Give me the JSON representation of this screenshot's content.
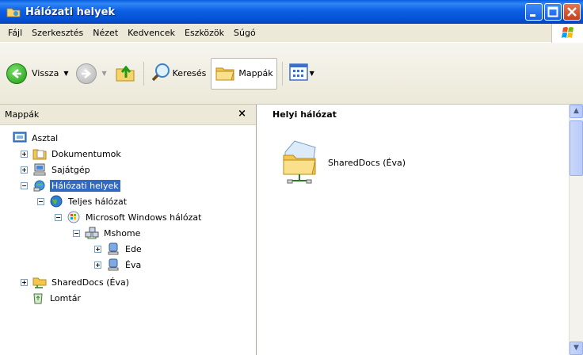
{
  "window": {
    "title": "Hálózati helyek"
  },
  "menu": [
    "Fájl",
    "Szerkesztés",
    "Nézet",
    "Kedvencek",
    "Eszközök",
    "Súgó"
  ],
  "toolbar": {
    "back_label": "Vissza",
    "search_label": "Keresés",
    "folders_label": "Mappák"
  },
  "folder_pane": {
    "title": "Mappák",
    "close_glyph": "×",
    "tree": [
      {
        "label": "Asztal"
      },
      {
        "label": "Dokumentumok",
        "expander": "+"
      },
      {
        "label": "Sajátgép",
        "expander": "+"
      },
      {
        "label": "Hálózati helyek",
        "expander": "−",
        "selected": true
      },
      {
        "label": "Teljes hálózat",
        "expander": "−"
      },
      {
        "label": "Microsoft Windows hálózat",
        "expander": "−"
      },
      {
        "label": "Mshome",
        "expander": "−"
      },
      {
        "label": "Ede",
        "expander": "+"
      },
      {
        "label": "Éva",
        "expander": "+"
      },
      {
        "label": "SharedDocs (Éva)",
        "expander": "+"
      },
      {
        "label": "Lomtár"
      }
    ]
  },
  "content": {
    "group_header": "Helyi hálózat",
    "items": [
      {
        "label": "SharedDocs (Éva)"
      }
    ]
  },
  "colors": {
    "titlebar": "#0552d6",
    "selection": "#316ac5",
    "chrome": "#ece9d8"
  }
}
